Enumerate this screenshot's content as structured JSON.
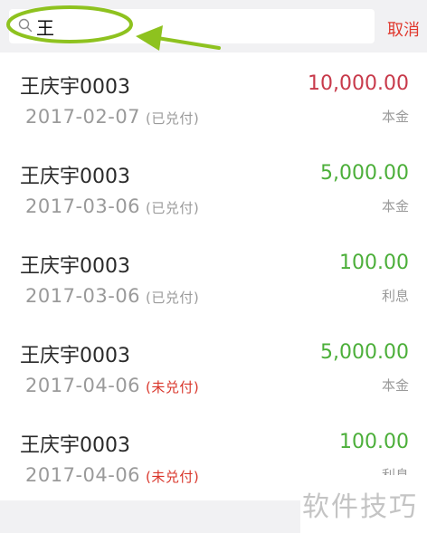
{
  "search": {
    "query": "王",
    "cancel_label": "取消"
  },
  "annotation": {
    "color": "#8ec21f"
  },
  "records": [
    {
      "name": "王庆宇0003",
      "date": "2017-02-07",
      "status": "(已兑付)",
      "status_type": "paid",
      "amount": "10,000.00",
      "amount_color": "red",
      "type": "本金"
    },
    {
      "name": "王庆宇0003",
      "date": "2017-03-06",
      "status": "(已兑付)",
      "status_type": "paid",
      "amount": "5,000.00",
      "amount_color": "green",
      "type": "本金"
    },
    {
      "name": "王庆宇0003",
      "date": "2017-03-06",
      "status": "(已兑付)",
      "status_type": "paid",
      "amount": "100.00",
      "amount_color": "green",
      "type": "利息"
    },
    {
      "name": "王庆宇0003",
      "date": "2017-04-06",
      "status": "(未兑付)",
      "status_type": "unpaid",
      "amount": "5,000.00",
      "amount_color": "green",
      "type": "本金"
    },
    {
      "name": "王庆宇0003",
      "date": "2017-04-06",
      "status": "(未兑付)",
      "status_type": "unpaid",
      "amount": "100.00",
      "amount_color": "green",
      "type": "利息"
    }
  ],
  "watermark": "软件技巧",
  "colors": {
    "red_amount": "#c83a4b",
    "green_amount": "#4caf3a",
    "unpaid_status": "#d9352a",
    "cancel": "#e0392e"
  }
}
